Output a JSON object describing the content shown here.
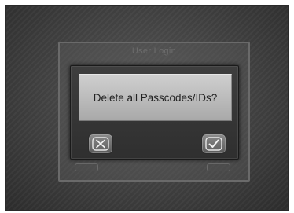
{
  "background_dialog": {
    "title": "User Login"
  },
  "confirm_dialog": {
    "message": "Delete all Passcodes/IDs?",
    "cancel_icon": "close-icon",
    "confirm_icon": "check-icon"
  },
  "colors": {
    "screen_bg": "#444444",
    "dialog_bg": "#333333",
    "message_bg": "#bdbdbd",
    "text": "#222222"
  }
}
